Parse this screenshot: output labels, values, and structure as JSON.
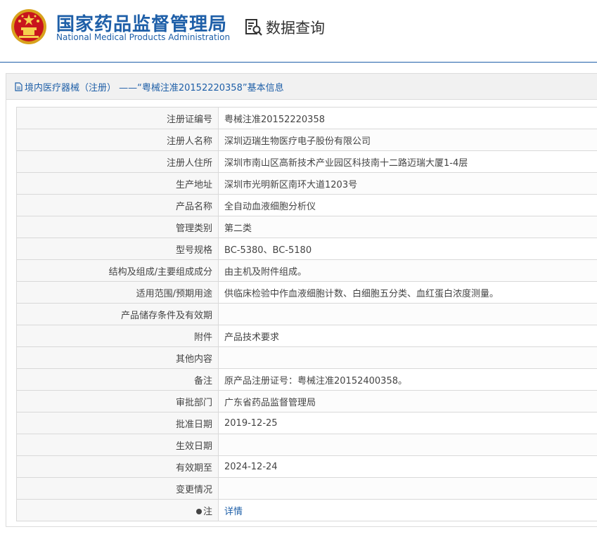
{
  "header": {
    "org_cn": "国家药品监督管理局",
    "org_en": "National Medical Products Administration",
    "query_title": "数据查询",
    "brand_color": "#1e5fa8"
  },
  "panel": {
    "title": "境内医疗器械（注册） ——“粤械注准20152220358”基本信息",
    "rows": [
      {
        "label": "注册证编号",
        "value": "粤械注准20152220358"
      },
      {
        "label": "注册人名称",
        "value": "深圳迈瑞生物医疗电子股份有限公司"
      },
      {
        "label": "注册人住所",
        "value": "深圳市南山区高新技术产业园区科技南十二路迈瑞大厦1-4层"
      },
      {
        "label": "生产地址",
        "value": "深圳市光明新区南环大道1203号"
      },
      {
        "label": "产品名称",
        "value": "全自动血液细胞分析仪"
      },
      {
        "label": "管理类别",
        "value": "第二类"
      },
      {
        "label": "型号规格",
        "value": "BC-5380、BC-5180"
      },
      {
        "label": "结构及组成/主要组成成分",
        "value": "由主机及附件组成。"
      },
      {
        "label": "适用范围/预期用途",
        "value": "供临床检验中作血液细胞计数、白细胞五分类、血红蛋白浓度测量。"
      },
      {
        "label": "产品储存条件及有效期",
        "value": ""
      },
      {
        "label": "附件",
        "value": "产品技术要求"
      },
      {
        "label": "其他内容",
        "value": ""
      },
      {
        "label": "备注",
        "value": "原产品注册证号：粤械注准20152400358。"
      },
      {
        "label": "审批部门",
        "value": "广东省药品监督管理局"
      },
      {
        "label": "批准日期",
        "value": "2019-12-25"
      },
      {
        "label": "生效日期",
        "value": ""
      },
      {
        "label": "有效期至",
        "value": "2024-12-24"
      },
      {
        "label": "变更情况",
        "value": ""
      }
    ],
    "note_row": {
      "label": "注",
      "value": "详情"
    }
  }
}
